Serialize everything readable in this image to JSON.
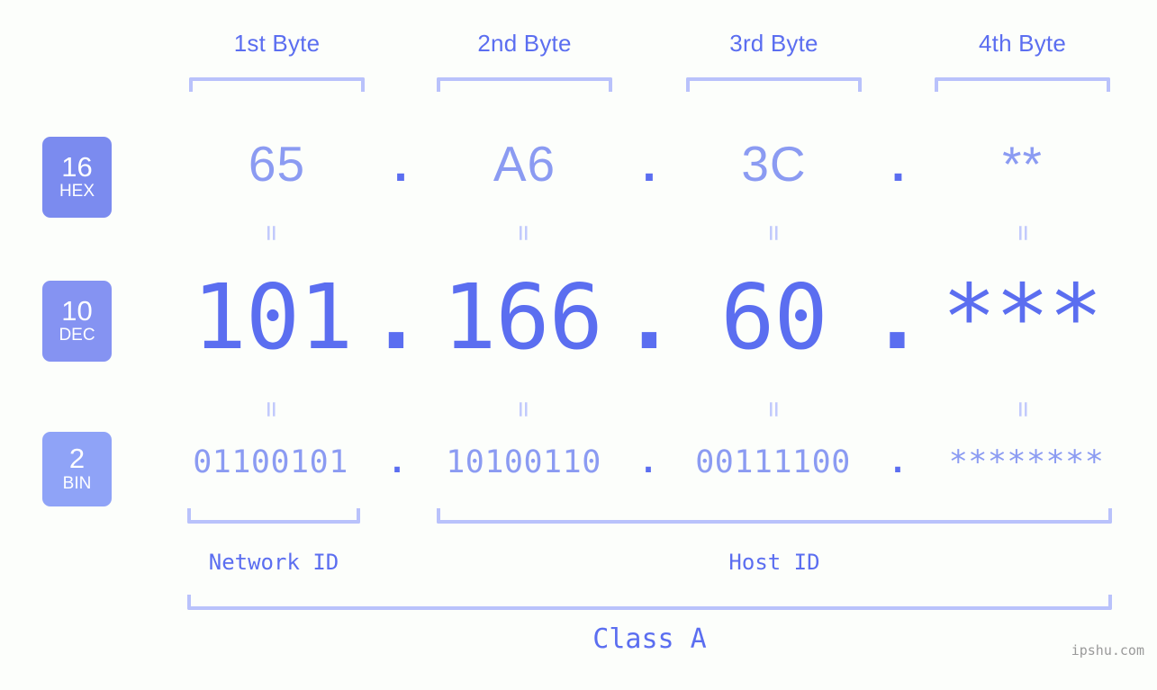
{
  "background": "#fcfefb",
  "colors": {
    "accent_dark": "#5b6ef0",
    "accent_light": "#8b9bf2",
    "bracket": "#b9c2fb",
    "equals": "#c2cafc",
    "badge_hex": "#7b8bef",
    "badge_dec": "#8593f2",
    "badge_bin": "#8fa3f7",
    "watermark": "#9a9a9a"
  },
  "byte_headers": [
    {
      "label": "1st Byte"
    },
    {
      "label": "2nd Byte"
    },
    {
      "label": "3rd Byte"
    },
    {
      "label": "4th Byte"
    }
  ],
  "bases": [
    {
      "number": "16",
      "unit": "HEX"
    },
    {
      "number": "10",
      "unit": "DEC"
    },
    {
      "number": "2",
      "unit": "BIN"
    }
  ],
  "rows": {
    "hex": {
      "values": [
        "65",
        "A6",
        "3C",
        "**"
      ],
      "separator": "."
    },
    "dec": {
      "values": [
        "101",
        "166",
        "60",
        "***"
      ],
      "separator": "."
    },
    "bin": {
      "values": [
        "01100101",
        "10100110",
        "00111100",
        "********"
      ],
      "separator": "."
    }
  },
  "equals_glyph": "=",
  "segments": {
    "network_id": "Network ID",
    "host_id": "Host ID"
  },
  "class_label": "Class A",
  "watermark": "ipshu.com"
}
